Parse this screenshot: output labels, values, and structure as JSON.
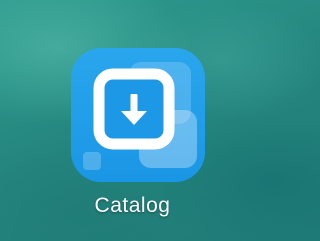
{
  "app": {
    "label": "Catalog",
    "icon": "download-tray-icon",
    "icon_color": "#1f9ee9"
  }
}
